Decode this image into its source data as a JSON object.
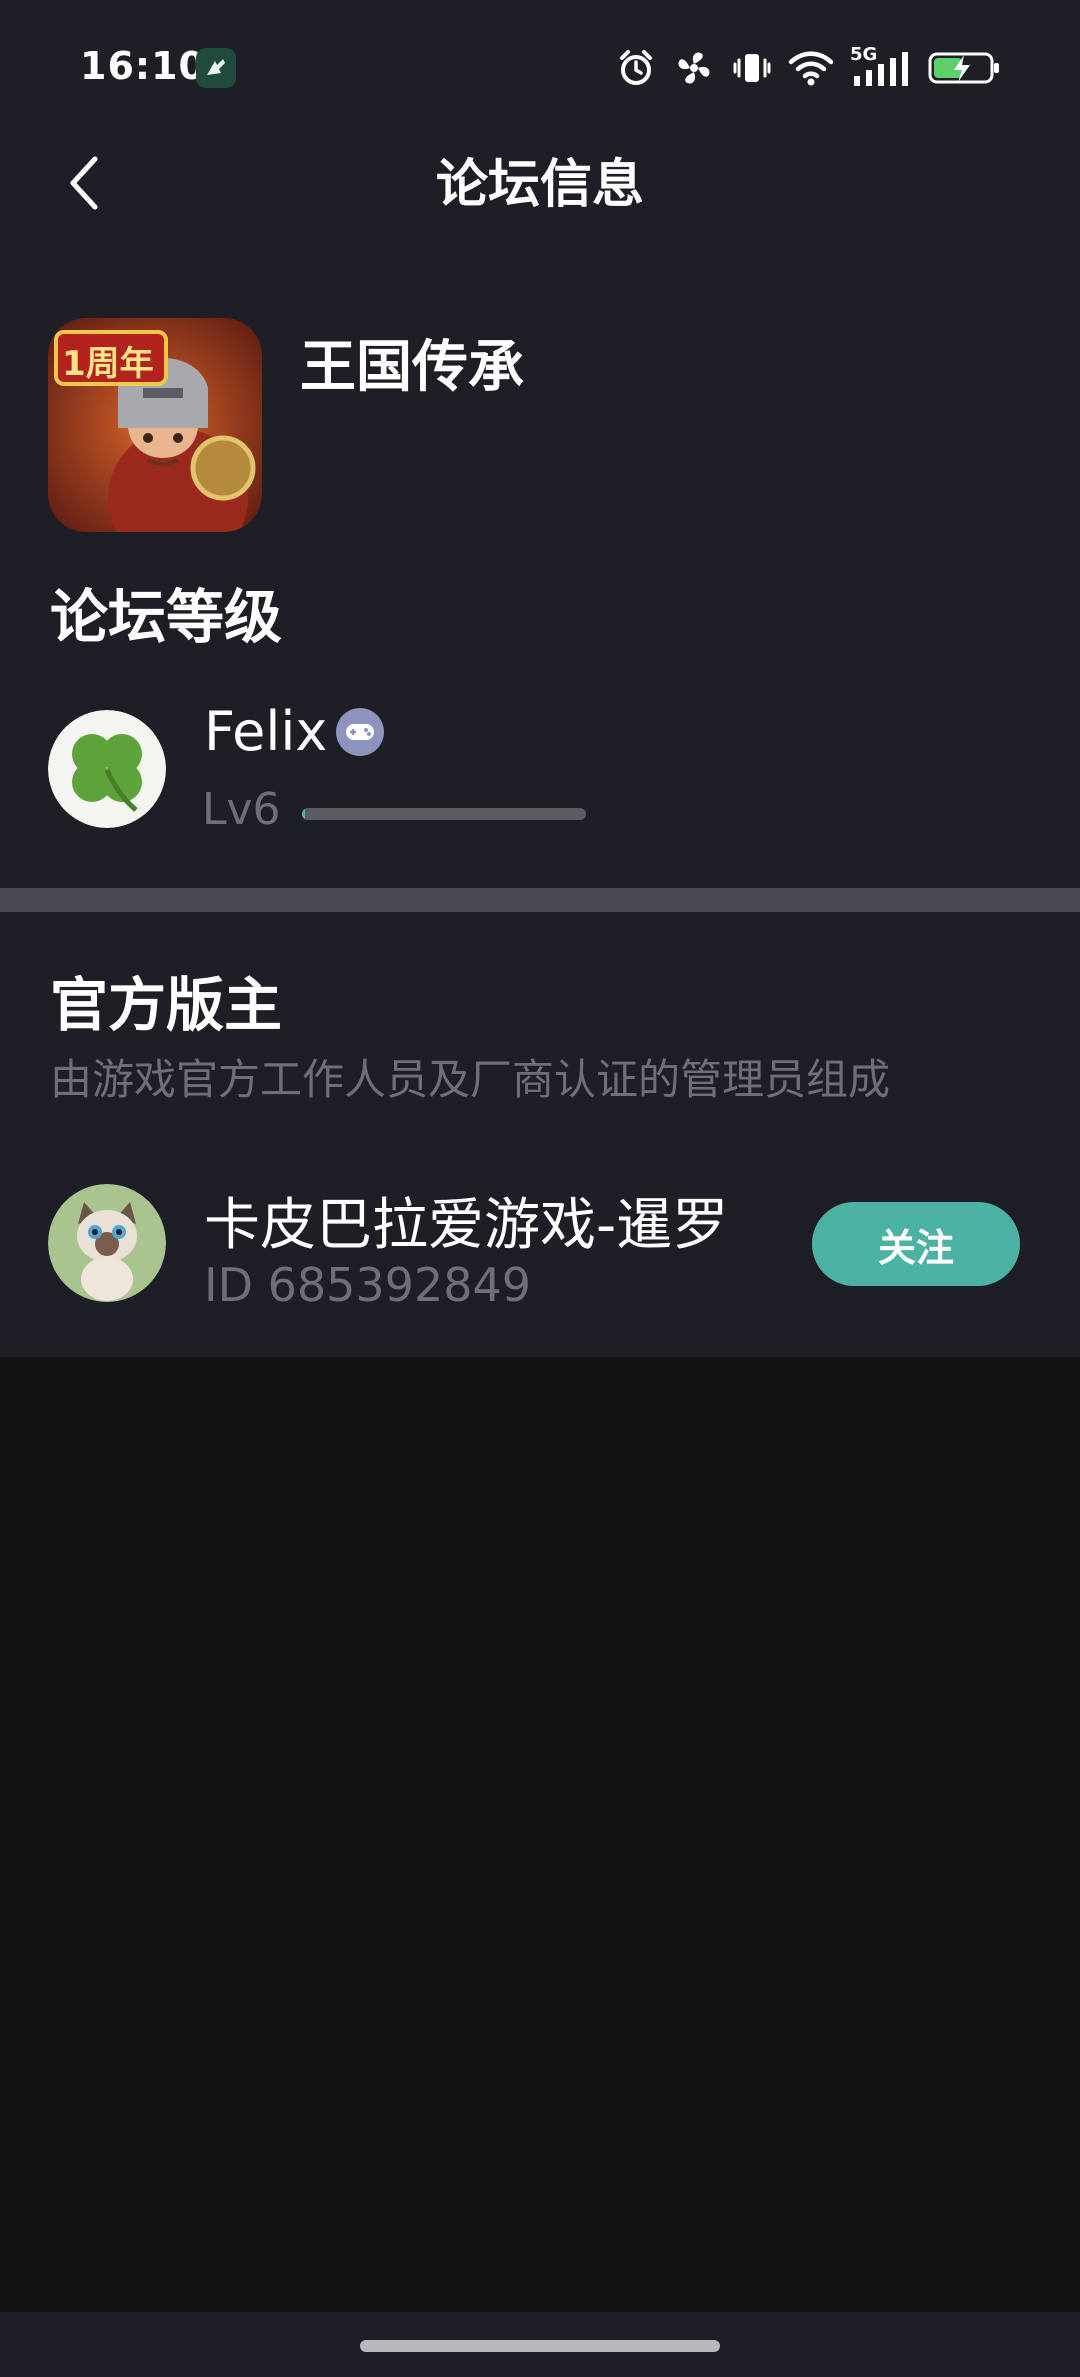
{
  "status_bar": {
    "time": "16:10",
    "network": "5G",
    "icons": [
      "app-notification-icon",
      "alarm-icon",
      "fan-icon",
      "vibrate-icon",
      "wifi-icon",
      "signal-icon",
      "battery-charging-icon"
    ]
  },
  "header": {
    "title": "论坛信息",
    "back_icon": "chevron-left-icon"
  },
  "game": {
    "name": "王国传承",
    "icon_badge": "1周年"
  },
  "forum_level": {
    "section_title": "论坛等级",
    "user_name": "Felix",
    "level": "Lv6",
    "progress": 0.01
  },
  "moderators": {
    "section_title": "官方版主",
    "description": "由游戏官方工作人员及厂商认证的管理员组成",
    "items": [
      {
        "name": "卡皮巴拉爱游戏-暹罗",
        "id_text": "ID 685392849",
        "follow_label": "关注"
      }
    ]
  },
  "colors": {
    "panel": "#1e1f26",
    "background": "#121414",
    "accent": "#4cb2a4",
    "muted_text": "#6f7076"
  }
}
